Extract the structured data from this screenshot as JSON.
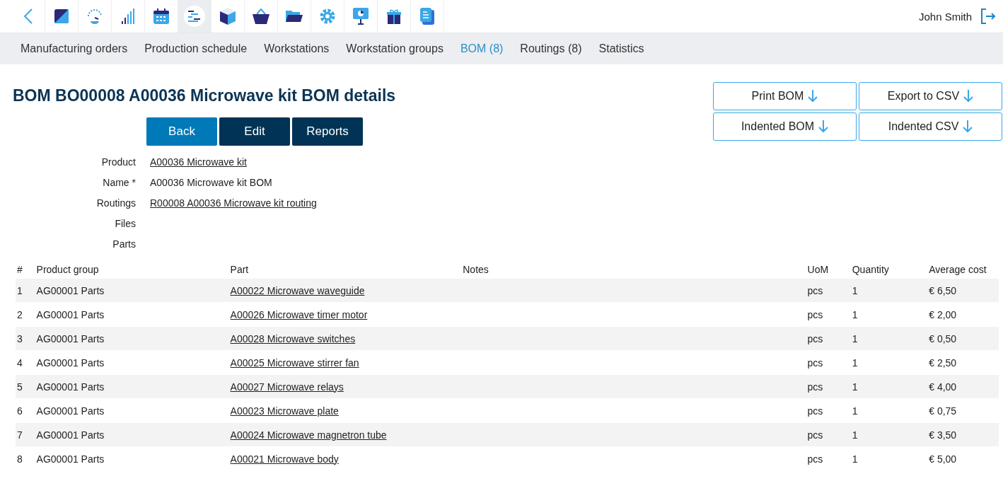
{
  "topbar": {
    "icons": [
      {
        "kind": "back",
        "selected": false
      },
      {
        "kind": "square",
        "selected": false
      },
      {
        "kind": "gauge",
        "selected": false
      },
      {
        "kind": "bars",
        "selected": false
      },
      {
        "kind": "calendar",
        "selected": false
      },
      {
        "kind": "gantt",
        "selected": true
      },
      {
        "kind": "cube",
        "selected": false
      },
      {
        "kind": "basket",
        "selected": false
      },
      {
        "kind": "folder",
        "selected": false
      },
      {
        "kind": "gear",
        "selected": false
      },
      {
        "kind": "presentation",
        "selected": false
      },
      {
        "kind": "gift",
        "selected": false
      },
      {
        "kind": "document",
        "selected": false
      }
    ],
    "user": "John Smith"
  },
  "nav": [
    {
      "label": "Manufacturing orders",
      "selected": false
    },
    {
      "label": "Production schedule",
      "selected": false
    },
    {
      "label": "Workstations",
      "selected": false
    },
    {
      "label": "Workstation groups",
      "selected": false
    },
    {
      "label": "BOM (8)",
      "selected": true
    },
    {
      "label": "Routings (8)",
      "selected": false
    },
    {
      "label": "Statistics",
      "selected": false
    }
  ],
  "title": "BOM BO00008 A00036 Microwave kit BOM details",
  "actions": [
    {
      "label": "Back",
      "kind": "primary"
    },
    {
      "label": "Edit",
      "kind": "dark"
    },
    {
      "label": "Reports",
      "kind": "dark"
    }
  ],
  "downloads": [
    "Print BOM",
    "Export to CSV",
    "Indented BOM",
    "Indented CSV"
  ],
  "fields": [
    {
      "label": "Product",
      "value": "A00036 Microwave kit",
      "kind": "link"
    },
    {
      "label": "Name *",
      "value": "A00036 Microwave kit BOM",
      "kind": "text"
    },
    {
      "label": "Routings",
      "value": "R00008 A00036 Microwave kit routing",
      "kind": "link"
    },
    {
      "label": "Files",
      "kind": "empty"
    },
    {
      "label": "Parts",
      "kind": "empty"
    }
  ],
  "table": {
    "columns": [
      "#",
      "Product group",
      "Part",
      "Notes",
      "UoM",
      "Quantity",
      "Average cost"
    ],
    "rows": [
      [
        "1",
        "AG00001 Parts",
        "A00022 Microwave waveguide",
        "",
        "pcs",
        "1",
        "€ 6,50"
      ],
      [
        "2",
        "AG00001 Parts",
        "A00026 Microwave timer motor",
        "",
        "pcs",
        "1",
        "€ 2,00"
      ],
      [
        "3",
        "AG00001 Parts",
        "A00028 Microwave switches",
        "",
        "pcs",
        "1",
        "€ 0,50"
      ],
      [
        "4",
        "AG00001 Parts",
        "A00025 Microwave stirrer fan",
        "",
        "pcs",
        "1",
        "€ 2,50"
      ],
      [
        "5",
        "AG00001 Parts",
        "A00027 Microwave relays",
        "",
        "pcs",
        "1",
        "€ 4,00"
      ],
      [
        "6",
        "AG00001 Parts",
        "A00023 Microwave plate",
        "",
        "pcs",
        "1",
        "€ 0,75"
      ],
      [
        "7",
        "AG00001 Parts",
        "A00024 Microwave magnetron tube",
        "",
        "pcs",
        "1",
        "€ 3,50"
      ],
      [
        "8",
        "AG00001 Parts",
        "A00021 Microwave body",
        "",
        "pcs",
        "1",
        "€ 5,00"
      ]
    ]
  }
}
